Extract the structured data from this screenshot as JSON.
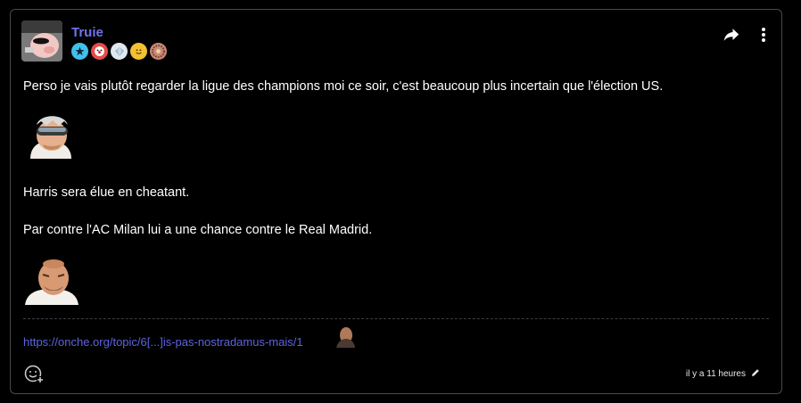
{
  "post": {
    "username": "Truie",
    "badges": [
      "star-badge",
      "clown-badge",
      "diamond-badge",
      "smile-badge",
      "flower-badge"
    ],
    "paragraphs": [
      "Perso je vais plutôt regarder la ligue des champions moi ce soir, c'est beaucoup plus incertain que l'élection US.",
      "Harris sera élue en cheatant.",
      "Par contre l'AC Milan lui a une chance contre le Real Madrid."
    ],
    "link_text": "https://onche.org/topic/6[...]is-pas-nostradamus-mais/1",
    "timestamp": "il y a 11 heures"
  },
  "colors": {
    "background": "#000000",
    "border": "#4a4a4a",
    "username": "#6f74ea",
    "link": "#5d63e0"
  },
  "icons": [
    "share-icon",
    "more-vertical-icon",
    "add-reaction-icon",
    "edit-icon"
  ]
}
